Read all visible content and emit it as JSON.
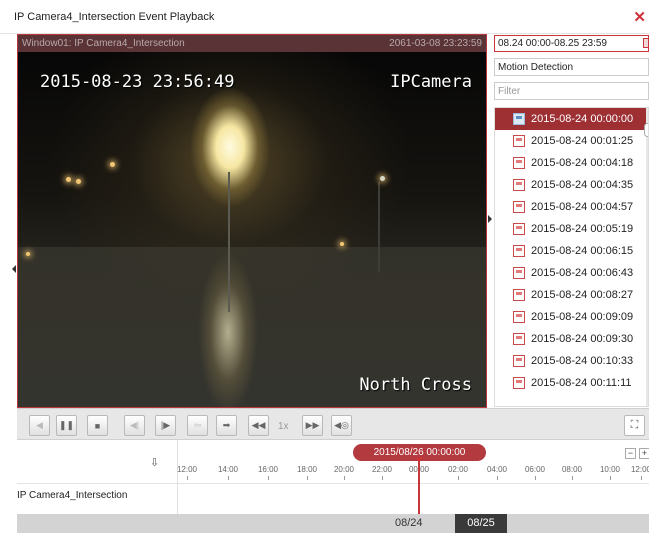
{
  "window": {
    "title": "IP Camera4_Intersection Event Playback",
    "close_glyph": "✕"
  },
  "video": {
    "window_label": "Window01: IP Camera4_Intersection",
    "window_time": "2061-03-08 23:23:59",
    "osd_timestamp": "2015-08-23 23:56:49",
    "osd_camera": "IPCamera",
    "osd_location": "North Cross"
  },
  "search_panel": {
    "time_range": "08.24 00:00-08.25 23:59",
    "event_type": "Motion Detection",
    "filter_placeholder": "Filter",
    "events": [
      "2015-08-24 00:00:00",
      "2015-08-24 00:01:25",
      "2015-08-24 00:04:18",
      "2015-08-24 00:04:35",
      "2015-08-24 00:04:57",
      "2015-08-24 00:05:19",
      "2015-08-24 00:06:15",
      "2015-08-24 00:06:43",
      "2015-08-24 00:08:27",
      "2015-08-24 00:09:09",
      "2015-08-24 00:09:30",
      "2015-08-24 00:10:33",
      "2015-08-24 00:11:11"
    ],
    "selected_index": 0
  },
  "controls": {
    "stop_glyph": "◀",
    "pause_glyph": "❚❚",
    "stop2_glyph": "■",
    "prev_frame_glyph": "◀|",
    "next_frame_glyph": "|▶",
    "back_glyph": "⇦",
    "forward_glyph": "➡",
    "slow_glyph": "◀◀",
    "speed": "1x",
    "fast_glyph": "▶▶",
    "audio_glyph": "◀◎",
    "fullscreen_glyph": "⛶"
  },
  "timeline": {
    "current_time": "2015/08/26 00:00:00",
    "download_glyph": "⇩",
    "camera_label": "IP Camera4_Intersection",
    "ticks": [
      "12:00",
      "14:00",
      "16:00",
      "18:00",
      "20:00",
      "22:00",
      "00:00",
      "02:00",
      "04:00",
      "06:00",
      "08:00",
      "10:00",
      "12:00"
    ],
    "zoom_out": "−",
    "zoom_in": "+"
  },
  "status": {
    "date_prev": "08/24",
    "date_current": "08/25"
  },
  "colors": {
    "accent": "#b33a3f",
    "selected_row": "#9e3034"
  }
}
